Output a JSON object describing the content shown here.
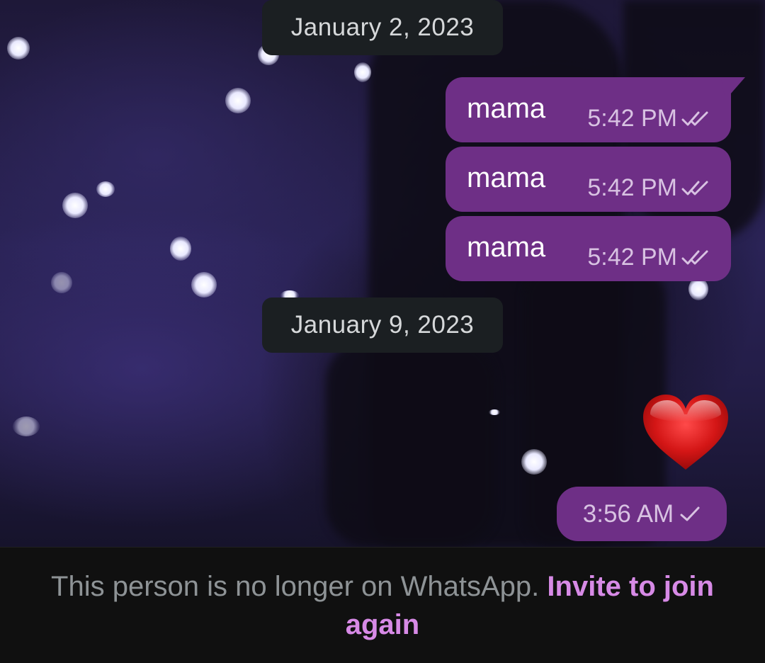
{
  "date_separators": [
    {
      "label": "January 2, 2023"
    },
    {
      "label": "January 9, 2023"
    }
  ],
  "messages": [
    {
      "text": "mama",
      "time": "5:42 PM",
      "status_icon": "double-check-icon"
    },
    {
      "text": "mama",
      "time": "5:42 PM",
      "status_icon": "double-check-icon"
    },
    {
      "text": "mama",
      "time": "5:42 PM",
      "status_icon": "double-check-icon"
    }
  ],
  "emoji_message": {
    "emoji": "heart-emoji",
    "time": "3:56 AM",
    "status_icon": "single-check-icon"
  },
  "footer": {
    "notice": "This person is no longer on WhatsApp.",
    "invite_link": "Invite to join again"
  },
  "colors": {
    "bubble": "#6e2f86",
    "date_chip": "#1b1f22",
    "link": "#d78ae6",
    "footer_bg": "#101010"
  }
}
